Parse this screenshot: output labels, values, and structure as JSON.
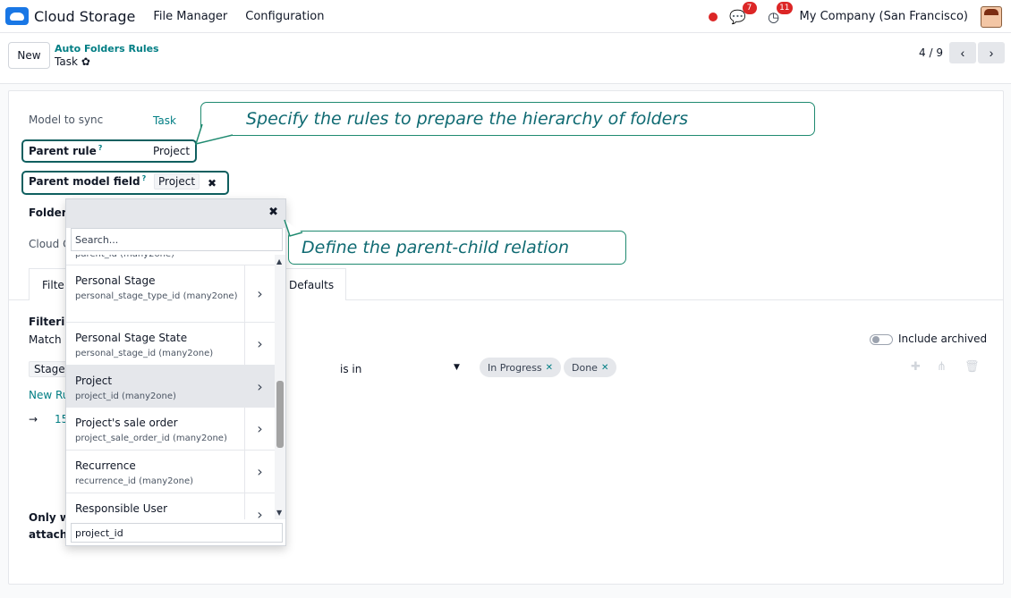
{
  "navbar": {
    "app_name": "Cloud Storage",
    "menus": [
      "File Manager",
      "Configuration"
    ],
    "messages_count": "7",
    "activities_count": "11",
    "company": "My Company (San Francisco)"
  },
  "control_panel": {
    "new_label": "New",
    "breadcrumb_parent": "Auto Folders Rules",
    "breadcrumb_current": "Task",
    "pager": "4 / 9"
  },
  "form": {
    "model_to_sync_label": "Model to sync",
    "model_to_sync_value": "Task",
    "parent_rule_label": "Parent rule",
    "parent_rule_value": "Project",
    "help_mark": "?",
    "parent_model_field_label": "Parent model field",
    "parent_model_field_value": "Project",
    "folder_label_partial": "Folder",
    "cloud_label_partial": "Cloud C",
    "tab_filters_partial": "Filte",
    "tab_defaults": "Defaults",
    "filtering_partial": "Filterin",
    "match_partial": "Match",
    "include_archived": "Include archived",
    "stage_partial": "Stage",
    "operator": "is in",
    "values": [
      "In Progress",
      "Done"
    ],
    "new_rule_partial": "New Ru",
    "records_arrow": "→",
    "records_partial": "15",
    "only_partial_1": "Only w",
    "only_partial_2": "attachi"
  },
  "popover": {
    "search_placeholder": "Search...",
    "top_cut_text": "parent_id (many2one)",
    "items": [
      {
        "name": "Personal Stage",
        "tech": "personal_stage_type_id (many2one)"
      },
      {
        "name": "Personal Stage State",
        "tech": "personal_stage_id (many2one)"
      },
      {
        "name": "Project",
        "tech": "project_id (many2one)"
      },
      {
        "name": "Project's sale order",
        "tech": "project_sale_order_id (many2one)"
      },
      {
        "name": "Recurrence",
        "tech": "recurrence_id (many2one)"
      },
      {
        "name": "Responsible User",
        "tech": ""
      }
    ],
    "path_value": "project_id"
  },
  "callouts": {
    "hierarchy": "Specify the rules to prepare the hierarchy of folders",
    "relation": "Define the parent-child relation"
  }
}
